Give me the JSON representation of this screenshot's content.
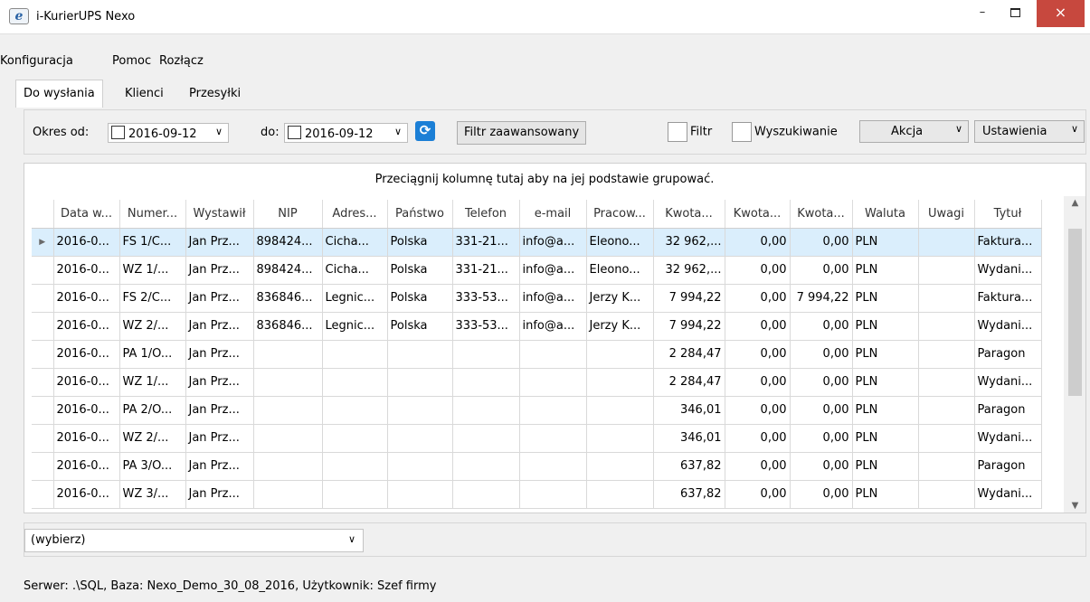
{
  "window": {
    "title": "i-KurierUPS Nexo",
    "icon": "e-logo-icon",
    "close": "×",
    "minimize": "–"
  },
  "menu": [
    "Konfiguracja",
    "Pomoc",
    "Rozłącz"
  ],
  "tabs": [
    {
      "label": "Do wysłania",
      "active": true
    },
    {
      "label": "Klienci"
    },
    {
      "label": "Przesyłki"
    }
  ],
  "toolbar": {
    "okres_label": "Okres od:",
    "from": "2016-09-12",
    "do_label": "do:",
    "to": "2016-09-12",
    "filter_adv": "Filtr zaawansowany",
    "filtr": "Filtr",
    "wyszukiwanie": "Wyszukiwanie",
    "akcja": "Akcja",
    "ustawienia": "Ustawienia"
  },
  "grid": {
    "group_hint": "Przeciągnij kolumnę tutaj aby na jej podstawie grupować.",
    "columns": [
      "Data w...",
      "Numer...",
      "Wystawił",
      "NIP",
      "Adres...",
      "Państwo",
      "Telefon",
      "e-mail",
      "Pracow...",
      "Kwota...",
      "Kwota...",
      "Kwota...",
      "Waluta",
      "Uwagi",
      "Tytuł"
    ],
    "rows": [
      [
        "2016-0...",
        "FS 1/C...",
        "Jan Prz...",
        "898424...",
        "Cicha...",
        "Polska",
        "331-21...",
        "info@a...",
        "Eleono...",
        "32 962,...",
        "0,00",
        "0,00",
        "PLN",
        "",
        "Faktura..."
      ],
      [
        "2016-0...",
        "WZ 1/...",
        "Jan Prz...",
        "898424...",
        "Cicha...",
        "Polska",
        "331-21...",
        "info@a...",
        "Eleono...",
        "32 962,...",
        "0,00",
        "0,00",
        "PLN",
        "",
        "Wydani..."
      ],
      [
        "2016-0...",
        "FS 2/C...",
        "Jan Prz...",
        "836846...",
        "Legnic...",
        "Polska",
        "333-53...",
        "info@a...",
        "Jerzy K...",
        "7 994,22",
        "0,00",
        "7 994,22",
        "PLN",
        "",
        "Faktura..."
      ],
      [
        "2016-0...",
        "WZ 2/...",
        "Jan Prz...",
        "836846...",
        "Legnic...",
        "Polska",
        "333-53...",
        "info@a...",
        "Jerzy K...",
        "7 994,22",
        "0,00",
        "0,00",
        "PLN",
        "",
        "Wydani..."
      ],
      [
        "2016-0...",
        "PA 1/O...",
        "Jan Prz...",
        "",
        "",
        "",
        "",
        "",
        "",
        "2 284,47",
        "0,00",
        "0,00",
        "PLN",
        "",
        "Paragon"
      ],
      [
        "2016-0...",
        "WZ 1/...",
        "Jan Prz...",
        "",
        "",
        "",
        "",
        "",
        "",
        "2 284,47",
        "0,00",
        "0,00",
        "PLN",
        "",
        "Wydani..."
      ],
      [
        "2016-0...",
        "PA 2/O...",
        "Jan Prz...",
        "",
        "",
        "",
        "",
        "",
        "",
        "346,01",
        "0,00",
        "0,00",
        "PLN",
        "",
        "Paragon"
      ],
      [
        "2016-0...",
        "WZ 2/...",
        "Jan Prz...",
        "",
        "",
        "",
        "",
        "",
        "",
        "346,01",
        "0,00",
        "0,00",
        "PLN",
        "",
        "Wydani..."
      ],
      [
        "2016-0...",
        "PA 3/O...",
        "Jan Prz...",
        "",
        "",
        "",
        "",
        "",
        "",
        "637,82",
        "0,00",
        "0,00",
        "PLN",
        "",
        "Paragon"
      ],
      [
        "2016-0...",
        "WZ 3/...",
        "Jan Prz...",
        "",
        "",
        "",
        "",
        "",
        "",
        "637,82",
        "0,00",
        "0,00",
        "PLN",
        "",
        "Wydani..."
      ]
    ],
    "selected_row": 0
  },
  "bottom": {
    "combo": "(wybierz)"
  },
  "status": "Serwer: .\\SQL, Baza: Nexo_Demo_30_08_2016, Użytkownik: Szef firmy"
}
